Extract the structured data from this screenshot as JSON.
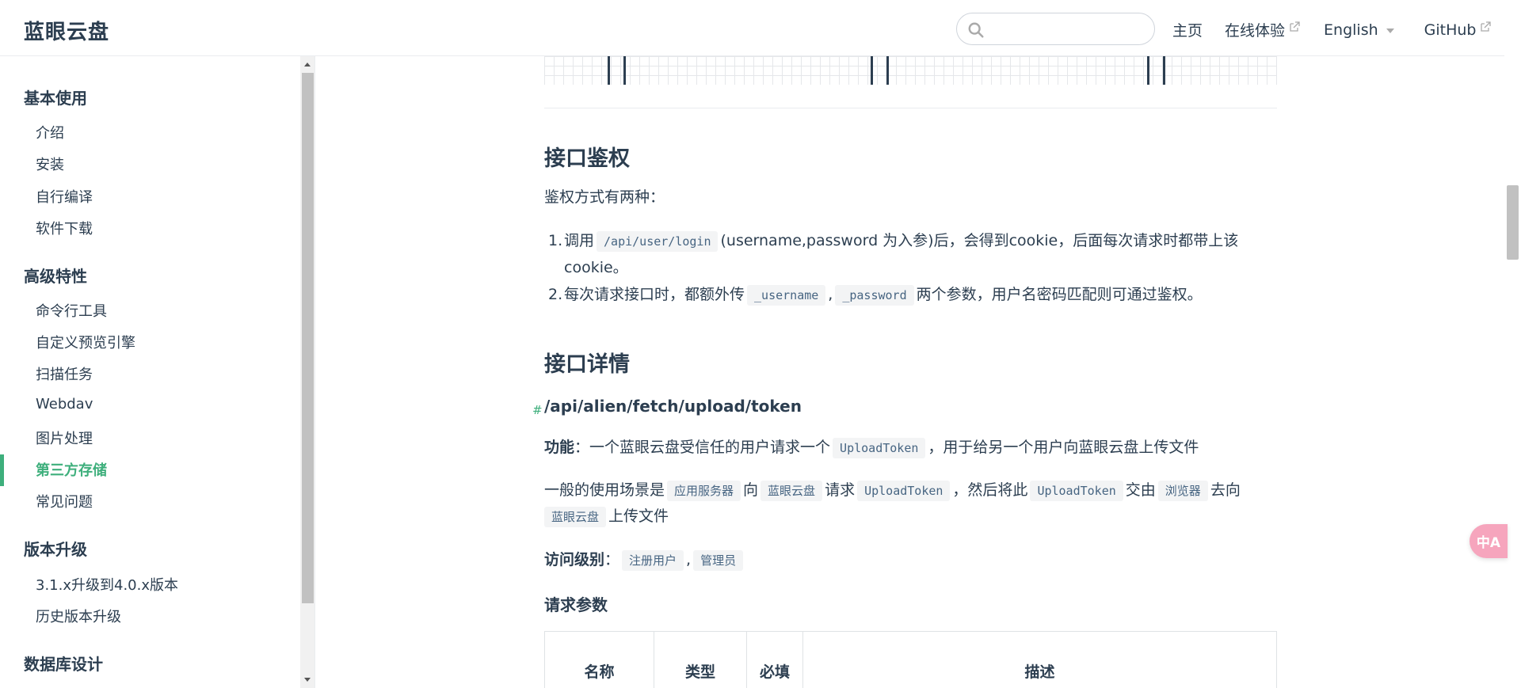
{
  "navbar": {
    "site_name": "蓝眼云盘",
    "search": {
      "value": "",
      "placeholder": ""
    },
    "links": [
      {
        "label": "主页",
        "external": false
      },
      {
        "label": "在线体验",
        "external": true
      },
      {
        "label": "English",
        "dropdown": true
      },
      {
        "label": "GitHub",
        "external": true
      }
    ]
  },
  "sidebar": {
    "groups": [
      {
        "title": "基本使用",
        "items": [
          "介绍",
          "安装",
          "自行编译",
          "软件下载"
        ]
      },
      {
        "title": "高级特性",
        "items": [
          "命令行工具",
          "自定义预览引擎",
          "扫描任务",
          "Webdav",
          "图片处理",
          "第三方存储",
          "常见问题"
        ]
      },
      {
        "title": "版本升级",
        "items": [
          "3.1.x升级到4.0.x版本",
          "历史版本升级"
        ]
      },
      {
        "title": "数据库设计",
        "items": []
      }
    ],
    "active_item": "第三方存储"
  },
  "content": {
    "auth": {
      "heading": "接口鉴权",
      "intro": "鉴权方式有两种：",
      "item1_num": "1.",
      "item1_a": "调用",
      "item1_code": "/api/user/login",
      "item1_b": "(username,password 为入参)后，会得到cookie，后面每次请求时都带上该",
      "item1_c": "cookie。",
      "item2_num": "2.",
      "item2_a": "每次请求接口时，都额外传",
      "item2_code1": "_username",
      "item2_sep": ",",
      "item2_code2": "_password",
      "item2_b": "两个参数，用户名密码匹配则可通过鉴权。"
    },
    "details": {
      "heading": "接口详情",
      "anchor": "#",
      "api_path": "/api/alien/fetch/upload/token",
      "func_label": "功能",
      "func_colon": "：",
      "func_a": "一个蓝眼云盘受信任的用户请求一个",
      "func_code": "UploadToken",
      "func_b": "，用于给另一个用户向蓝眼云盘上传文件",
      "scene_a": "一般的使用场景是",
      "scene_code1": "应用服务器",
      "scene_b": "向",
      "scene_code2": "蓝眼云盘",
      "scene_c": "请求",
      "scene_code3": "UploadToken",
      "scene_d": "，然后将此",
      "scene_code4": "UploadToken",
      "scene_e": "交由",
      "scene_code5": "浏览器",
      "scene_f": "去向",
      "scene_code6": "蓝眼云盘",
      "scene_g": "上传文件",
      "access_label": "访问级别",
      "access_colon": "：",
      "access_code1": "注册用户",
      "access_sep": ",",
      "access_code2": "管理员",
      "params_heading": "请求参数",
      "table_headers": [
        "名称",
        "类型",
        "必填",
        "描述"
      ]
    }
  },
  "translate_button": {
    "label": "中A"
  },
  "colors": {
    "accent": "#3eaf7c",
    "text": "#2c3e50",
    "code_bg": "#f3f4f5",
    "code_text": "#476582"
  }
}
